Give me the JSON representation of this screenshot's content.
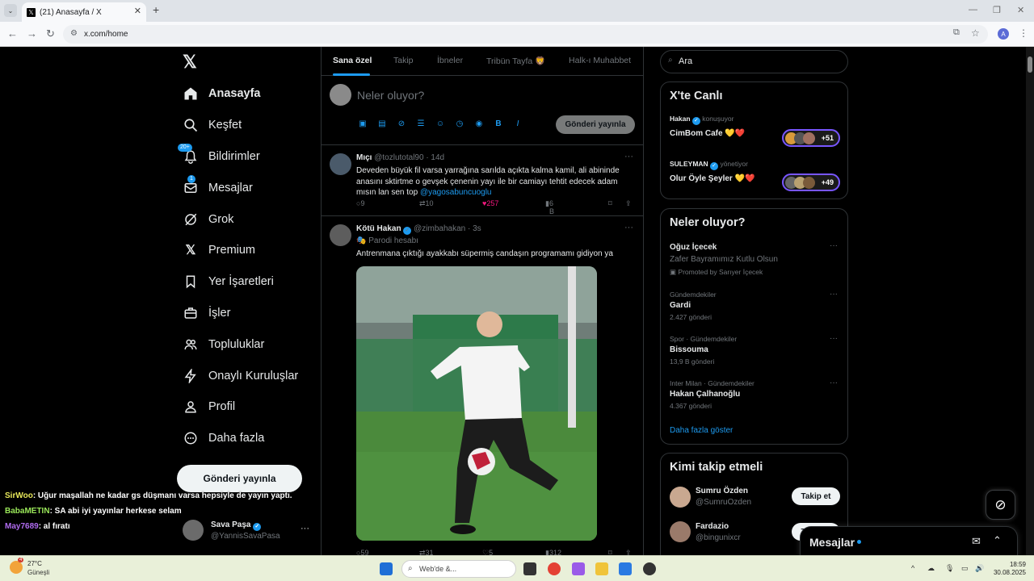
{
  "browser": {
    "tab_title": "(21) Anasayfa / X",
    "url": "x.com/home",
    "profile_initial": "A"
  },
  "nav": {
    "items": [
      {
        "label": "Anasayfa",
        "icon": "home-icon",
        "active": true
      },
      {
        "label": "Keşfet",
        "icon": "search-icon"
      },
      {
        "label": "Bildirimler",
        "icon": "bell-icon",
        "badge": "20+"
      },
      {
        "label": "Mesajlar",
        "icon": "mail-icon",
        "badge": "1"
      },
      {
        "label": "Grok",
        "icon": "grok-icon"
      },
      {
        "label": "Premium",
        "icon": "x-icon"
      },
      {
        "label": "Yer İşaretleri",
        "icon": "bookmark-icon"
      },
      {
        "label": "İşler",
        "icon": "briefcase-icon"
      },
      {
        "label": "Topluluklar",
        "icon": "people-icon"
      },
      {
        "label": "Onaylı Kuruluşlar",
        "icon": "lightning-icon"
      },
      {
        "label": "Profil",
        "icon": "person-icon"
      },
      {
        "label": "Daha fazla",
        "icon": "more-circle-icon"
      }
    ],
    "post_button": "Gönderi yayınla"
  },
  "profile": {
    "name": "Sava Paşa",
    "handle": "@YannisSavaPasa"
  },
  "chat_overlay": [
    {
      "user": "SirWoo",
      "text": ": Uğur maşallah ne kadar gs düşmanı varsa hepsiyle de yayın yaptı.",
      "color": "#e8e85a"
    },
    {
      "user": "BabaMETIN",
      "text": ": SA abi iyi yayınlar herkese selam",
      "color": "#9be85a"
    },
    {
      "user": "May7689",
      "text": ": al fıratı",
      "color": "#b06cf0"
    }
  ],
  "feed_tabs": [
    "Sana özel",
    "Takip",
    "İbneler",
    "Tribün Tayfa 🦁",
    "Halk-ı Muhabbet"
  ],
  "composer": {
    "placeholder": "Neler oluyor?",
    "post_button": "Gönderi yayınla"
  },
  "tweets": [
    {
      "name": "Mıçı",
      "handle": "@tozlutotal90",
      "time": "· 14d",
      "text": "Deveden büyük fil varsa yarrağına sarılda açıkta kalma kamil, ali abininde anasını sktirtme o gevşek çenenin yayı ile bir camiayı tehtit edecek adam mısın lan sen top",
      "mention": "@yagosabuncuoglu",
      "replies": "9",
      "reposts": "10",
      "likes": "257",
      "views": "6 B"
    },
    {
      "name": "Kötü Hakan",
      "handle": "@zimbahakan",
      "time": "· 3s",
      "label": "Parodi hesabı",
      "text": "Antrenmana çıktığı ayakkabı süpermiş candaşın programamı gidiyon ya",
      "replies": "59",
      "reposts": "31",
      "likes": "5 B",
      "views": "312 B"
    }
  ],
  "search": {
    "placeholder": "Ara"
  },
  "live": {
    "title": "X'te Canlı",
    "items": [
      {
        "host": "Hakan",
        "status": "konuşuyor",
        "title": "CimBom Cafe 💛❤️",
        "count": "+51"
      },
      {
        "host": "SULEYMAN",
        "status": "yönetiyor",
        "title": "Olur Öyle Şeyler 💛❤️",
        "count": "+49"
      }
    ]
  },
  "trends": {
    "title": "Neler oluyor?",
    "promoted": {
      "name": "Oğuz İçecek",
      "text": "Zafer Bayramımız Kutlu Olsun",
      "by": "Promoted by Sarıyer İçecek"
    },
    "items": [
      {
        "context": "Gündemdekiler",
        "name": "Gardi",
        "posts": "2.427 gönderi"
      },
      {
        "context": "Spor · Gündemdekiler",
        "name": "Bissouma",
        "posts": "13,9 B gönderi"
      },
      {
        "context": "Inter Milan · Gündemdekiler",
        "name": "Hakan Çalhanoğlu",
        "posts": "4.367 gönderi"
      }
    ],
    "show_more": "Daha fazla göster"
  },
  "who_to_follow": {
    "title": "Kimi takip etmeli",
    "items": [
      {
        "name": "Sumru Özden",
        "handle": "@SumruOzden",
        "button": "Takip et"
      },
      {
        "name": "Fardazio",
        "handle": "@bingunixcr",
        "button": "Takip et"
      }
    ]
  },
  "messages_drawer": {
    "title": "Mesajlar"
  },
  "taskbar": {
    "temp": "27°C",
    "place": "Güneşli",
    "weather_badge": "4",
    "search": "Web'de &...",
    "time": "18:59",
    "date": "30.08.2025"
  }
}
